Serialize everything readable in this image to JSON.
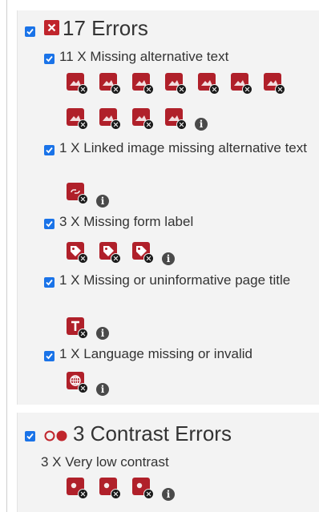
{
  "errors": {
    "title": "17 Errors",
    "items": [
      {
        "label": "11 X Missing alternative text",
        "icon": "image-error-icon",
        "count": 11
      },
      {
        "label": "1 X Linked image missing alternative text",
        "icon": "linked-image-error-icon",
        "count": 1
      },
      {
        "label": "3 X Missing form label",
        "icon": "form-label-error-icon",
        "count": 3
      },
      {
        "label": "1 X Missing or uninformative page title",
        "icon": "page-title-error-icon",
        "count": 1
      },
      {
        "label": "1 X Language missing or invalid",
        "icon": "language-error-icon",
        "count": 1
      }
    ]
  },
  "contrast": {
    "title": "3 Contrast Errors",
    "items": [
      {
        "label": "3 X Very low contrast",
        "icon": "contrast-error-icon",
        "count": 3
      }
    ]
  },
  "info_glyph": "i",
  "colors": {
    "error_red": "#c0252c",
    "checkbox_blue": "#1a73e8",
    "panel_bg": "#f3f3f3"
  }
}
